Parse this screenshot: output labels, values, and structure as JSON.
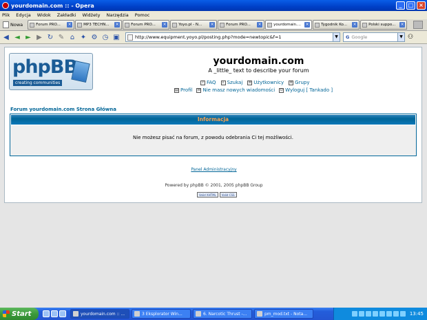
{
  "window": {
    "title": "yourdomain.com :: - Opera"
  },
  "menu": [
    "Plik",
    "Edycja",
    "Widok",
    "Zakładki",
    "Widżety",
    "Narzędzia",
    "Pomoc"
  ],
  "tabs": {
    "new_label": "Nowa",
    "items": [
      {
        "label": "Forum PRO...",
        "active": false
      },
      {
        "label": "MP3 TECHN...",
        "active": false
      },
      {
        "label": "Forum PRO...",
        "active": false
      },
      {
        "label": "Yoyo.pl - N...",
        "active": false
      },
      {
        "label": "Forum PRO...",
        "active": false
      },
      {
        "label": "yourdomain....",
        "active": true
      },
      {
        "label": "Tygodnik Ko...",
        "active": false
      },
      {
        "label": "Polski suppo...",
        "active": false
      }
    ]
  },
  "address": {
    "url": "http://www.equipment.yoyo.pl/posting.php?mode=newtopic&f=1",
    "search_placeholder": "Google",
    "search_engine_icon": "G"
  },
  "site": {
    "logo_text": "phpBB",
    "logo_tagline": "creating communities",
    "name": "yourdomain.com",
    "description": "A _little_ text to describe your forum",
    "nav_row1": [
      {
        "icon": "faq-icon",
        "label": "FAQ"
      },
      {
        "icon": "search-icon",
        "label": "Szukaj"
      },
      {
        "icon": "users-icon",
        "label": "Użytkownicy"
      },
      {
        "icon": "groups-icon",
        "label": "Grupy"
      }
    ],
    "nav_row2": [
      {
        "icon": "profile-icon",
        "label": "Profil"
      },
      {
        "icon": "messages-icon",
        "label": "Nie masz nowych wiadomości"
      },
      {
        "icon": "logout-icon",
        "label": "Wyloguj [ Tankado ]"
      }
    ],
    "breadcrumb": "Forum yourdomain.com Strona Główna",
    "info_title": "Informacja",
    "info_message": "Nie możesz pisać na forum, z powodu odebrania Ci tej możliwości.",
    "admin_link": "Panel Administracyjny",
    "powered_by": "Powered by phpBB © 2001, 2005 phpBB Group",
    "badges": [
      "Valid XHTML",
      "Valid CSS"
    ]
  },
  "taskbar": {
    "start_label": "Start",
    "tasks": [
      {
        "label": "yourdomain.com :: ...",
        "active": true
      },
      {
        "label": "3 Eksplorator Win...",
        "active": false
      },
      {
        "label": "6. Narcotic Thrust -...",
        "active": false
      },
      {
        "label": "pm_mod.txt - Nota...",
        "active": false
      }
    ],
    "clock": "13:45"
  }
}
